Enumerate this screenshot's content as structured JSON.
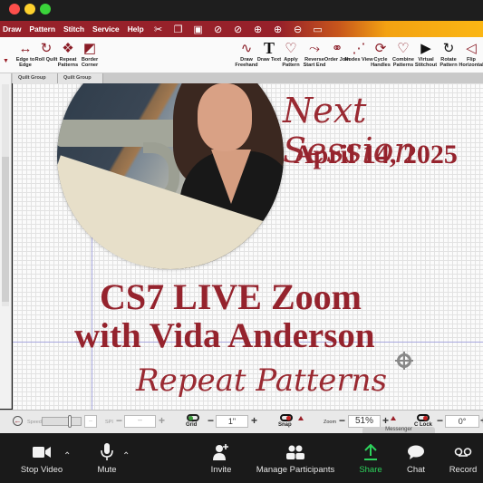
{
  "app": {
    "menus": [
      "Draw",
      "Pattern",
      "Stitch",
      "Service",
      "Help"
    ],
    "menu_icons": [
      "scissors-icon",
      "copy-icon",
      "paste-icon",
      "no-icon-1",
      "no-icon-2",
      "target-icon",
      "zoom-in-icon",
      "zoom-out-icon",
      "monitor-icon"
    ],
    "ribbon_tools": [
      {
        "label": "Edge to Edge",
        "icon": "edge-to-edge-icon",
        "glyph": "↔"
      },
      {
        "label": "Roll Quilt",
        "icon": "roll-quilt-icon",
        "glyph": "↻"
      },
      {
        "label": "Repeat Patterns",
        "icon": "repeat-patterns-icon",
        "glyph": "❖"
      },
      {
        "label": "Border Corner",
        "icon": "border-corner-icon",
        "glyph": "◩"
      },
      {
        "label": "Draw Freehand",
        "icon": "draw-freehand-icon",
        "glyph": "∿"
      },
      {
        "label": "Draw Text",
        "icon": "draw-text-icon",
        "glyph": "T"
      },
      {
        "label": "Apply Pattern",
        "icon": "apply-pattern-icon",
        "glyph": "♡"
      },
      {
        "label": "Reverse Start End",
        "icon": "reverse-start-end-icon",
        "glyph": "⤳"
      },
      {
        "label": "Order Join",
        "icon": "order-join-icon",
        "glyph": "⚭"
      },
      {
        "label": "Nodes View",
        "icon": "nodes-view-icon",
        "glyph": "⋰"
      },
      {
        "label": "Cycle Handles",
        "icon": "cycle-handles-icon",
        "glyph": "⟳"
      },
      {
        "label": "Combine Patterns",
        "icon": "combine-patterns-icon",
        "glyph": "♡"
      },
      {
        "label": "Virtual Stitchout",
        "icon": "virtual-stitchout-icon",
        "glyph": "▶"
      },
      {
        "label": "Rotate Pattern",
        "icon": "rotate-pattern-icon",
        "glyph": "↻"
      },
      {
        "label": "Flip Horizontal",
        "icon": "flip-horizontal-icon",
        "glyph": "◁"
      }
    ],
    "tabs": [
      "Quilt Group",
      "Quilt Group"
    ]
  },
  "canvas": {
    "heading_script": "Next Session",
    "date": "April 14, 2025",
    "title_line1": "CS7 LIVE Zoom",
    "title_line2": "with Vida Anderson",
    "subtitle_script": "Repeat Patterns",
    "accent_color": "#95232d"
  },
  "statusbar": {
    "speed_label": "Speed",
    "speed_value": "--",
    "spi_label": "SPI",
    "spi_value": "--",
    "grid_label": "Grid",
    "grid_value": "1\"",
    "snap_label": "Snap",
    "zoom_label": "Zoom",
    "zoom_value": "51%",
    "clock_label": "C Lock",
    "angle_value": "0°",
    "messenger_label": "Messenger"
  },
  "zoom_controls": {
    "stop_video": "Stop Video",
    "mute": "Mute",
    "invite": "Invite",
    "manage_participants": "Manage Participants",
    "share": "Share",
    "chat": "Chat",
    "record": "Record",
    "share_color": "#2dd35c"
  }
}
